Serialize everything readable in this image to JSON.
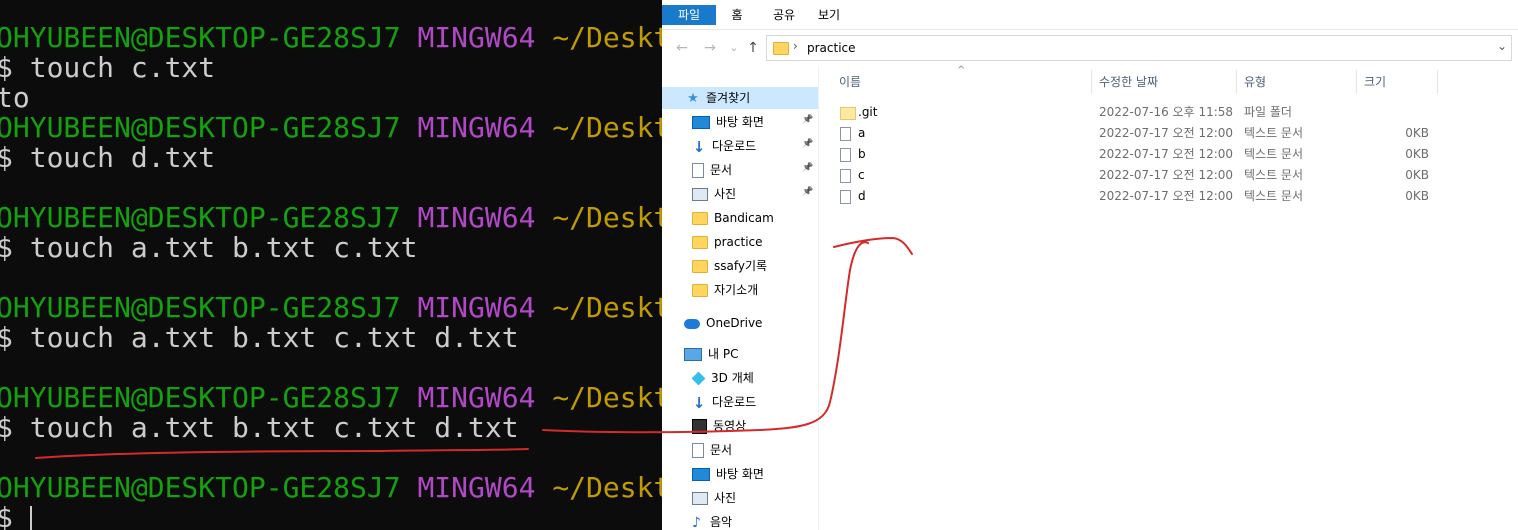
{
  "terminal": {
    "prompt_user": "OHYUBEEN@DESKTOP-GE28SJ7",
    "prompt_env": "MINGW64",
    "prompt_path": "~/Deskt",
    "lines": [
      {
        "kind": "prompt"
      },
      {
        "kind": "cmd",
        "text": "$ touch c.txt"
      },
      {
        "kind": "out",
        "text": "to"
      },
      {
        "kind": "prompt"
      },
      {
        "kind": "cmd",
        "text": "$ touch d.txt"
      },
      {
        "kind": "blank",
        "text": ""
      },
      {
        "kind": "prompt"
      },
      {
        "kind": "cmd",
        "text": "$ touch a.txt b.txt c.txt"
      },
      {
        "kind": "blank",
        "text": ""
      },
      {
        "kind": "prompt"
      },
      {
        "kind": "cmd",
        "text": "$ touch a.txt b.txt c.txt d.txt"
      },
      {
        "kind": "blank",
        "text": ""
      },
      {
        "kind": "prompt"
      },
      {
        "kind": "cmd",
        "text": "$ touch a.txt b.txt c.txt d.txt"
      },
      {
        "kind": "blank",
        "text": ""
      },
      {
        "kind": "prompt"
      },
      {
        "kind": "cursor",
        "text": "$"
      }
    ]
  },
  "explorer": {
    "ribbon_tabs": [
      {
        "label": "파일",
        "active": true
      },
      {
        "label": "홈",
        "active": false
      },
      {
        "label": "공유",
        "active": false
      },
      {
        "label": "보기",
        "active": false
      }
    ],
    "nav_buttons": {
      "back": "←",
      "forward": "→",
      "recent": "⌄",
      "up": "↑"
    },
    "address": {
      "separator": "›",
      "path": "practice",
      "dropdown": "⌄"
    },
    "nav_pane": [
      {
        "label": "즐겨찾기",
        "icon": "star-icon",
        "selected": true,
        "pinned": false,
        "indent": 0
      },
      {
        "label": "바탕 화면",
        "icon": "desktop-icon",
        "selected": false,
        "pinned": true,
        "indent": 1
      },
      {
        "label": "다운로드",
        "icon": "download-icon",
        "selected": false,
        "pinned": true,
        "indent": 1
      },
      {
        "label": "문서",
        "icon": "document-icon",
        "selected": false,
        "pinned": true,
        "indent": 1
      },
      {
        "label": "사진",
        "icon": "picture-icon",
        "selected": false,
        "pinned": true,
        "indent": 1
      },
      {
        "label": "Bandicam",
        "icon": "folder-icon",
        "selected": false,
        "pinned": false,
        "indent": 1
      },
      {
        "label": "practice",
        "icon": "folder-icon",
        "selected": false,
        "pinned": false,
        "indent": 1
      },
      {
        "label": "ssafy기록",
        "icon": "folder-icon",
        "selected": false,
        "pinned": false,
        "indent": 1
      },
      {
        "label": "자기소개",
        "icon": "folder-icon",
        "selected": false,
        "pinned": false,
        "indent": 1
      },
      {
        "label": "OneDrive",
        "icon": "cloud-icon",
        "selected": false,
        "pinned": false,
        "indent": 0
      },
      {
        "label": "내 PC",
        "icon": "pc-icon",
        "selected": false,
        "pinned": false,
        "indent": 0
      },
      {
        "label": "3D 개체",
        "icon": "3d-objects-icon",
        "selected": false,
        "pinned": false,
        "indent": 1
      },
      {
        "label": "다운로드",
        "icon": "download-icon",
        "selected": false,
        "pinned": false,
        "indent": 1
      },
      {
        "label": "동영상",
        "icon": "video-icon",
        "selected": false,
        "pinned": false,
        "indent": 1
      },
      {
        "label": "문서",
        "icon": "document-icon",
        "selected": false,
        "pinned": false,
        "indent": 1
      },
      {
        "label": "바탕 화면",
        "icon": "desktop-icon",
        "selected": false,
        "pinned": false,
        "indent": 1
      },
      {
        "label": "사진",
        "icon": "picture-icon",
        "selected": false,
        "pinned": false,
        "indent": 1
      },
      {
        "label": "음악",
        "icon": "music-icon",
        "selected": false,
        "pinned": false,
        "indent": 1
      }
    ],
    "columns": [
      "이름",
      "수정한 날짜",
      "유형",
      "크기"
    ],
    "sort_indicator": "^",
    "files": [
      {
        "name": ".git",
        "modified": "2022-07-16 오후 11:58",
        "type": "파일 폴더",
        "size": "",
        "icon": "folder"
      },
      {
        "name": "a",
        "modified": "2022-07-17 오전 12:00",
        "type": "텍스트 문서",
        "size": "0KB",
        "icon": "file"
      },
      {
        "name": "b",
        "modified": "2022-07-17 오전 12:00",
        "type": "텍스트 문서",
        "size": "0KB",
        "icon": "file"
      },
      {
        "name": "c",
        "modified": "2022-07-17 오전 12:00",
        "type": "텍스트 문서",
        "size": "0KB",
        "icon": "file"
      },
      {
        "name": "d",
        "modified": "2022-07-17 오전 12:00",
        "type": "텍스트 문서",
        "size": "0KB",
        "icon": "file"
      }
    ]
  },
  "colors": {
    "terminal_user": "#13a10e",
    "terminal_env": "#b148c6",
    "terminal_path": "#c19c00",
    "annotation": "#d42a2a",
    "ribbon_active": "#1979ca",
    "nav_selected": "#cce8ff"
  }
}
